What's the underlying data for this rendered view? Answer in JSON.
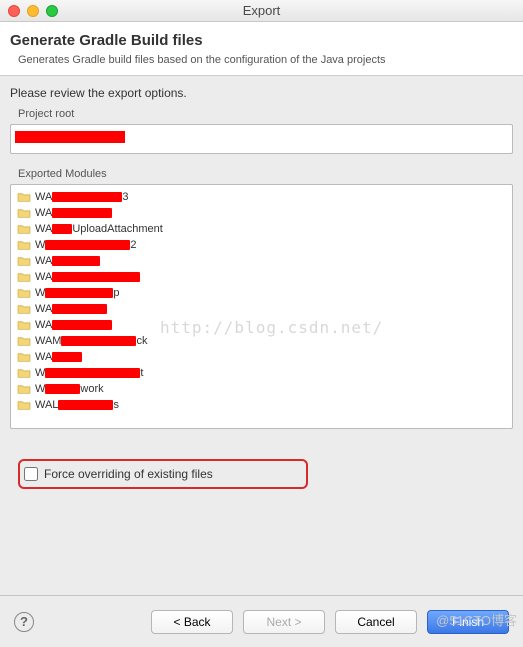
{
  "window": {
    "title": "Export"
  },
  "header": {
    "heading": "Generate Gradle Build files",
    "subtext": "Generates Gradle build files based on the configuration of the Java projects"
  },
  "review_label": "Please review the export options.",
  "project_root": {
    "label": "Project root",
    "value": ""
  },
  "exported_modules": {
    "label": "Exported Modules",
    "items": [
      {
        "prefix": "WA",
        "suffix": "3"
      },
      {
        "prefix": "WA",
        "suffix": ""
      },
      {
        "prefix": "WA",
        "suffix": "UploadAttachment"
      },
      {
        "prefix": "W",
        "suffix": "2"
      },
      {
        "prefix": "WA",
        "suffix": ""
      },
      {
        "prefix": "WA",
        "suffix": ""
      },
      {
        "prefix": "W",
        "suffix": "p"
      },
      {
        "prefix": "WA",
        "suffix": ""
      },
      {
        "prefix": "WA",
        "suffix": ""
      },
      {
        "prefix": "WAM",
        "suffix": "ck"
      },
      {
        "prefix": "WA",
        "suffix": ""
      },
      {
        "prefix": "W",
        "suffix": "t"
      },
      {
        "prefix": "W",
        "suffix": "work"
      },
      {
        "prefix": "WAL",
        "suffix": "s"
      }
    ]
  },
  "checkbox": {
    "label": "Force overriding of existing files",
    "checked": false
  },
  "buttons": {
    "back": "< Back",
    "next": "Next >",
    "cancel": "Cancel",
    "finish": "Finish"
  },
  "watermark": "@51CTO博客",
  "csdn": "http://blog.csdn.net/"
}
